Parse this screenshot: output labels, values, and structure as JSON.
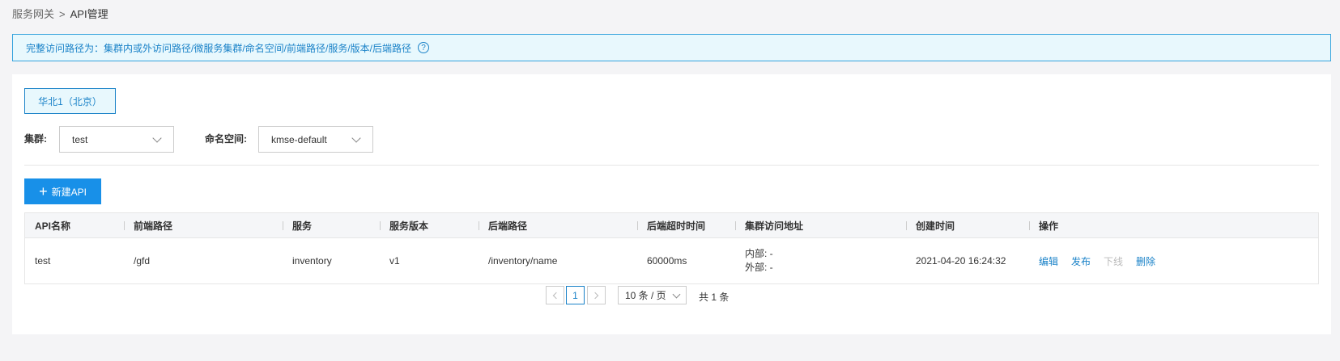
{
  "breadcrumb": {
    "parent": "服务网关",
    "separator": ">",
    "current": "API管理"
  },
  "notice": {
    "text": "完整访问路径为：集群内或外访问路径/微服务集群/命名空间/前端路径/服务/版本/后端路径",
    "help_glyph": "?"
  },
  "region_tab": {
    "label": "华北1（北京）"
  },
  "filters": {
    "cluster_label": "集群:",
    "cluster_value": "test",
    "namespace_label": "命名空间:",
    "namespace_value": "kmse-default"
  },
  "toolbar": {
    "new_plus": "+",
    "new_label": "新建API"
  },
  "table": {
    "headers": [
      "API名称",
      "前端路径",
      "服务",
      "服务版本",
      "后端路径",
      "后端超时时间",
      "集群访问地址",
      "创建时间",
      "操作"
    ],
    "rows": [
      {
        "name": "test",
        "frontend_path": "/gfd",
        "service": "inventory",
        "version": "v1",
        "backend_path": "/inventory/name",
        "timeout": "60000ms",
        "internal_addr": "内部: -",
        "external_addr": "外部: -",
        "created": "2021-04-20 16:24:32",
        "actions": {
          "edit": "编辑",
          "publish": "发布",
          "offline": "下线",
          "delete": "删除"
        }
      }
    ]
  },
  "pagination": {
    "current_page": "1",
    "page_size": "10 条 / 页",
    "total": "共 1 条"
  },
  "colors": {
    "accent": "#1a82c8",
    "primary_button": "#1890e8",
    "notice_bg": "#e8f8fd"
  },
  "icons": {
    "help": "help-circle-icon",
    "plus": "plus-icon",
    "chevron": "chevron-down-icon",
    "prev": "chevron-left-icon",
    "next": "chevron-right-icon"
  }
}
